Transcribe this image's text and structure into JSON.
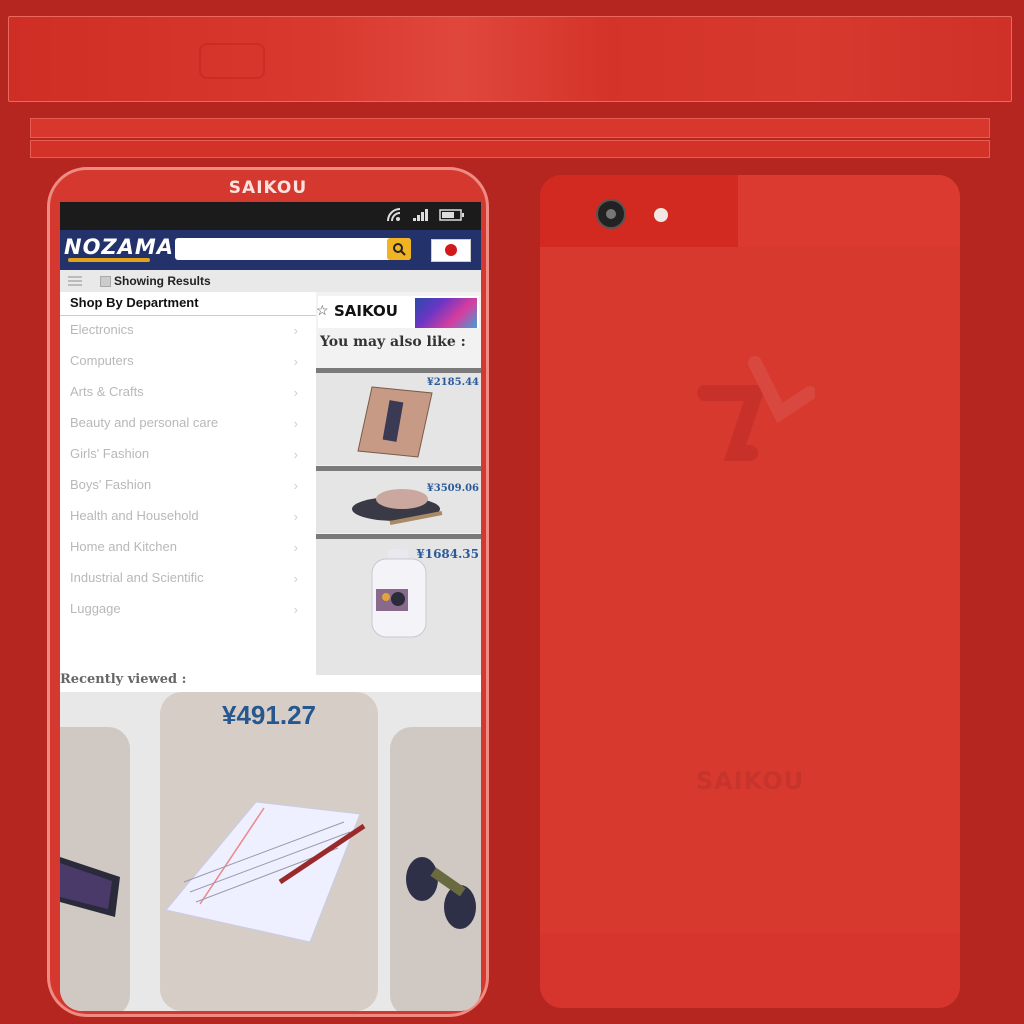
{
  "brand": "SAIKOU",
  "store": {
    "logo": "NOZAMA",
    "search_placeholder": "",
    "subbar_text": "Showing Results",
    "department_title": "Shop By Department",
    "departments": [
      "Electronics",
      "Computers",
      "Arts & Crafts",
      "Beauty and personal care",
      "Girls' Fashion",
      "Boys' Fashion",
      "Health and Household",
      "Home and Kitchen",
      "Industrial and Scientific",
      "Luggage"
    ],
    "chevron": "›",
    "banner_text": "SAIKOU",
    "recommend_title": "You may also like :",
    "recommended": [
      {
        "price": "¥2185.44",
        "icon": "poster-image"
      },
      {
        "price": "¥3509.06",
        "icon": "shoe-image"
      },
      {
        "price": "¥1684.35",
        "icon": "bottle-image"
      }
    ],
    "recent_label": "Recently viewed :",
    "recent_featured_price": "¥491.27"
  },
  "colors": {
    "background": "#b52620",
    "phone_red": "#d5382f",
    "nav_blue": "#23326b",
    "search_button": "#f0b323",
    "price_blue": "#27578f"
  },
  "icons": [
    "wifi-icon",
    "signal-icon",
    "battery-icon",
    "search-icon",
    "menu-icon",
    "flag-japan-icon",
    "camera-icon",
    "flash-icon",
    "brand-logo-icon"
  ]
}
